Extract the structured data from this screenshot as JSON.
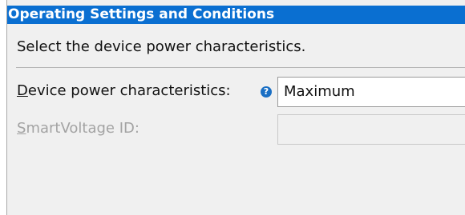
{
  "section": {
    "title": "Operating Settings and Conditions",
    "description": "Select the device power characteristics."
  },
  "fields": {
    "power": {
      "label_mnemonic": "D",
      "label_rest": "evice power characteristics:",
      "help_icon": "question-circle-icon",
      "help_glyph": "?",
      "value": "Maximum",
      "enabled": true
    },
    "voltage": {
      "label_mnemonic": "S",
      "label_rest": "martVoltage ID:",
      "value": "",
      "enabled": false
    }
  },
  "colors": {
    "title_bar": "#0a6fd1",
    "panel_background": "#f0f0f0",
    "disabled_text": "#a3a3a3",
    "help_icon": "#1a6fc4"
  }
}
